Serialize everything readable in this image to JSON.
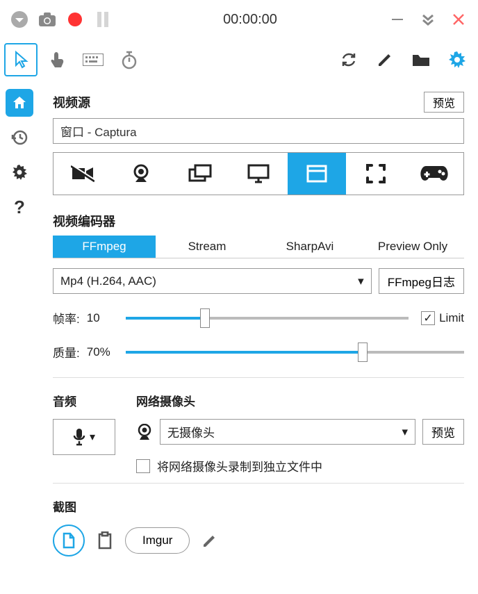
{
  "titlebar": {
    "timer": "00:00:00"
  },
  "video_source": {
    "title": "视频源",
    "preview_btn": "预览",
    "value": "窗口 - Captura"
  },
  "encoder": {
    "title": "视频编码器",
    "tabs": [
      "FFmpeg",
      "Stream",
      "SharpAvi",
      "Preview Only"
    ],
    "selected": "Mp4 (H.264, AAC)",
    "log_btn": "FFmpeg日志",
    "fps_label": "帧率:",
    "fps_value": "10",
    "limit_label": "Limit",
    "quality_label": "质量:",
    "quality_value": "70%"
  },
  "audio": {
    "title": "音频"
  },
  "webcam": {
    "title": "网络摄像头",
    "selected": "无摄像头",
    "preview_btn": "预览",
    "separate_label": "将网络摄像头录制到独立文件中"
  },
  "screenshot": {
    "title": "截图",
    "imgur": "Imgur"
  }
}
